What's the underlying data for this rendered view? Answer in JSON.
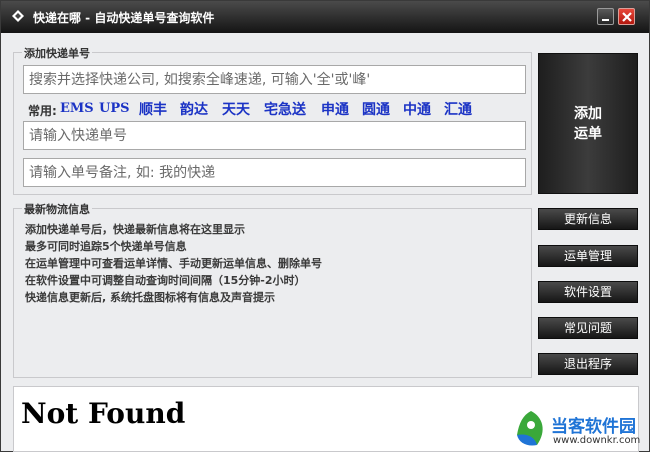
{
  "window": {
    "title": "快递在哪 - 自动快递单号查询软件"
  },
  "add_group": {
    "legend": "添加快递单号",
    "company_search_placeholder": "搜索并选择快递公司, 如搜索全峰速递, 可输入'全'或'峰'",
    "common_label": "常用:",
    "common_companies": [
      "EMS",
      "UPS",
      "顺丰",
      "韵达",
      "天天",
      "宅急送",
      "申通",
      "圆通",
      "中通",
      "汇通"
    ],
    "tracking_number_placeholder": "请输入快递单号",
    "note_placeholder": "请输入单号备注, 如: 我的快递"
  },
  "add_button_label": "添加\n运单",
  "info_group": {
    "legend": "最新物流信息",
    "lines": [
      "添加快递单号后，快递最新信息将在这里显示",
      "最多可同时追踪5个快递单号信息",
      "在运单管理中可查看运单详情、手动更新运单信息、删除单号",
      "在软件设置中可调整自动查询时间间隔（15分钟-2小时）",
      "快递信息更新后, 系统托盘图标将有信息及声音提示"
    ]
  },
  "side_buttons": [
    "更新信息",
    "运单管理",
    "软件设置",
    "常见问题",
    "退出程序"
  ],
  "bottom_panel": {
    "text": "Not Found"
  },
  "watermark": {
    "name": "当客软件园",
    "url": "www.downkr.com"
  },
  "colors": {
    "link_blue": "#1b33c5",
    "close_red": "#d0261a",
    "watermark_blue": "#1f74d6"
  }
}
